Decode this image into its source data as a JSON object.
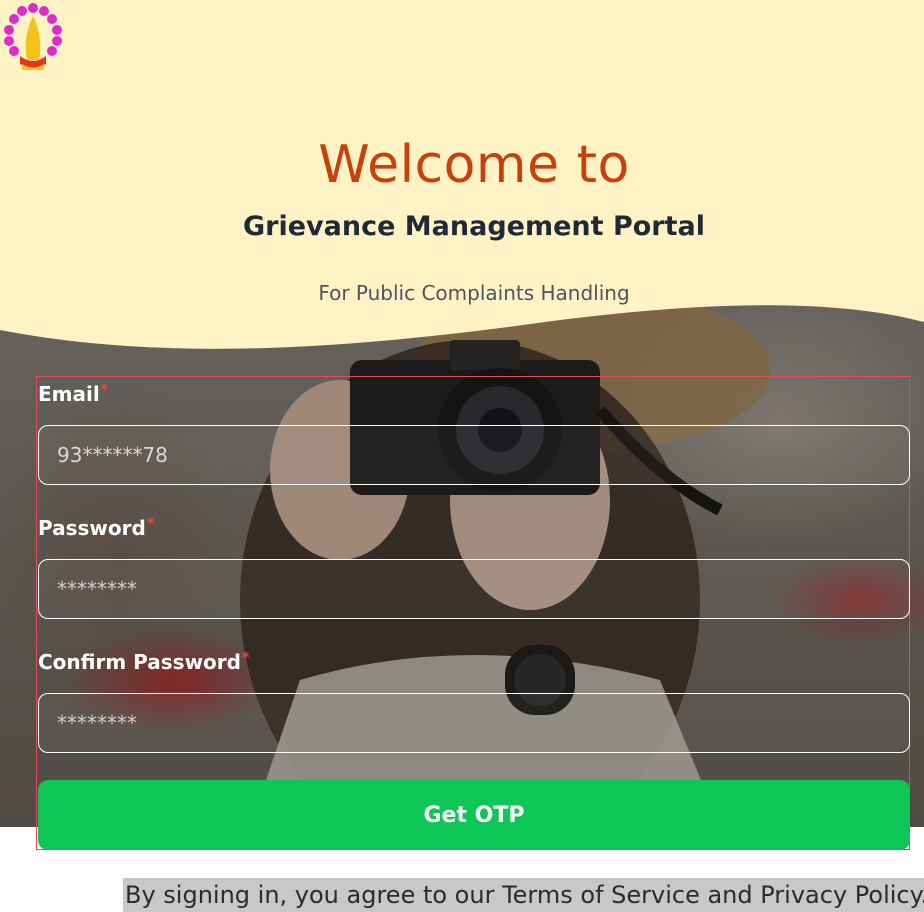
{
  "header": {
    "logo_icon": "lotus-hands-logo",
    "welcome": "Welcome to",
    "portal_name": "Grievance Management Portal",
    "tagline": "For Public Complaints Handling"
  },
  "form": {
    "email": {
      "label": "Email",
      "required_mark": "*",
      "value": "93******78"
    },
    "password": {
      "label": "Password",
      "required_mark": "*",
      "placeholder": "********"
    },
    "confirm_password": {
      "label": "Confirm Password",
      "required_mark": "*",
      "placeholder": "********"
    },
    "submit_label": "Get OTP"
  },
  "footer": {
    "terms": "By signing in, you agree to our Terms of Service and Privacy Policy."
  },
  "colors": {
    "cream": "#fff2c4",
    "title": "#c8400a",
    "button": "#0ec655"
  }
}
